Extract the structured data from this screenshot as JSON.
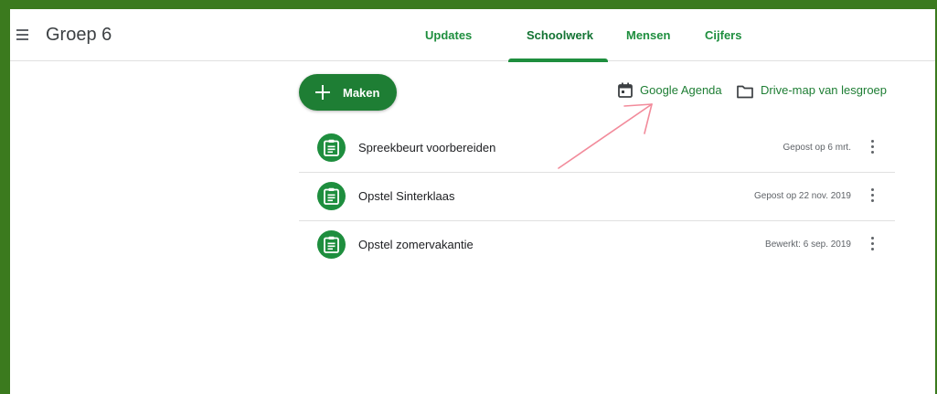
{
  "header": {
    "class_title": "Groep 6",
    "menu_icon": "hamburger-menu-icon"
  },
  "tabs": [
    {
      "label": "Updates",
      "active": false
    },
    {
      "label": "Schoolwerk",
      "active": true
    },
    {
      "label": "Mensen",
      "active": false
    },
    {
      "label": "Cijfers",
      "active": false
    }
  ],
  "toolbar": {
    "create_label": "Maken",
    "calendar_label": "Google Agenda",
    "drive_label": "Drive-map van lesgroep"
  },
  "assignments": [
    {
      "title": "Spreekbeurt voorbereiden",
      "date": "Gepost op 6 mrt."
    },
    {
      "title": "Opstel Sinterklaas",
      "date": "Gepost op 22 nov. 2019"
    },
    {
      "title": "Opstel zomervakantie",
      "date": "Bewerkt: 6 sep. 2019"
    }
  ],
  "colors": {
    "accent": "#1e8e3e",
    "frame": "#3b7a1e",
    "annotation_arrow": "#f28b9b"
  }
}
